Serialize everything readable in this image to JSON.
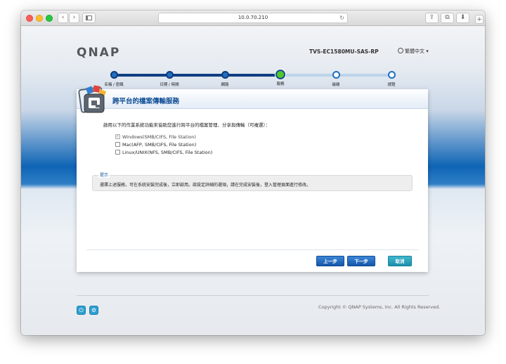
{
  "browser": {
    "url": "10.0.70.210",
    "reload_glyph": "↻",
    "back_glyph": "‹",
    "forward_glyph": "›",
    "share_glyph": "⇪",
    "tabs_glyph": "⧉",
    "download_glyph": "⬇",
    "new_tab_glyph": "+"
  },
  "header": {
    "logo": "QNAP",
    "model": "TVS-EC1580MU-SAS-RP",
    "language": "繁體中文 ▾"
  },
  "steps": [
    {
      "label": "名稱 / 密碼",
      "state": "done"
    },
    {
      "label": "日期 / 時間",
      "state": "done"
    },
    {
      "label": "網路",
      "state": "done"
    },
    {
      "label": "服務",
      "state": "current"
    },
    {
      "label": "磁碟",
      "state": "todo"
    },
    {
      "label": "總覽",
      "state": "todo"
    }
  ],
  "panel": {
    "title": "跨平台的檔案傳輸服務",
    "description": "啟用以下的作業系統功能來協助您進行跨平台的檔案管理、分享與傳輸（可複選）：",
    "options": [
      {
        "label": "Windows(SMB/CIFS, File Station)",
        "checked": true
      },
      {
        "label": "Mac(AFP, SMB/CIFS, File Station)",
        "checked": false
      },
      {
        "label": "Linux/UNIX(NFS, SMB/CIFS, File Station)",
        "checked": false
      }
    ],
    "tip_title": "提示",
    "tip_text": "選擇上述服務，可在系統安裝完成後，立即啟用。欲設定詳細的選項，請在完成安裝後，登入管理頁面進行修改。",
    "buttons": {
      "prev": "上一步",
      "next": "下一步",
      "cancel": "取消"
    }
  },
  "footer": {
    "copyright": "Copyright © QNAP Systems, Inc. All Rights Reserved.",
    "power_glyph": "⏻",
    "settings_glyph": "⚙"
  },
  "colors": {
    "accent": "#1557a8",
    "step_current": "#4ec92a",
    "cancel": "#1b8fab"
  }
}
